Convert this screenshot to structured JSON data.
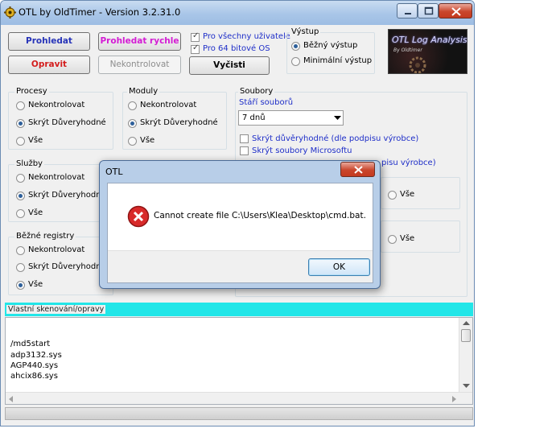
{
  "window": {
    "title": "OTL by OldTimer - Version 3.2.31.0"
  },
  "toolbar": {
    "scan_label": "Prohledat",
    "quick_scan_label": "Prohledat rychle",
    "fix_label": "Opravit",
    "no_check_label": "Nekontrolovat",
    "clean_label": "Vyčisti",
    "all_users_label": "Pro všechny uživatele",
    "x64_label": "Pro 64 bitové OS"
  },
  "output": {
    "title": "Výstup",
    "standard_label": "Běžný výstup",
    "minimal_label": "Minimální výstup"
  },
  "logo": {
    "title": "OTL Log Analysis",
    "subtitle": "By Oldtimer"
  },
  "processes": {
    "title": "Procesy",
    "opt1": "Nekontrolovat",
    "opt2": "Skrýt Důveryhodné",
    "opt3": "Vše"
  },
  "modules": {
    "title": "Moduly",
    "opt1": "Nekontrolovat",
    "opt2": "Skrýt Důveryhodné",
    "opt3": "Vše"
  },
  "files": {
    "title": "Soubory",
    "age_label": "Stáří souborů",
    "age_value": "7 dnů",
    "trusted_label": "Skrýt důvěryhodné (dle podpisu výrobce)",
    "microsoft_label": "Skrýt soubory Microsoftu",
    "partial_text": "pisu výrobce)"
  },
  "services": {
    "title": "Služby",
    "opt1": "Nekontrolovat",
    "opt2": "Skrýt Důveryhodné",
    "opt3": "Vše"
  },
  "registry": {
    "title": "Běžné registry",
    "opt1": "Nekontrolovat",
    "opt2": "Skrýt Důveryhodné",
    "opt3": "Vše"
  },
  "right_groups": {
    "all1": "Vše",
    "all2": "Vše"
  },
  "custom": {
    "title": "Vlastní skenování/opravy",
    "lines": [
      "/md5start",
      "adp3132.sys",
      "AGP440.sys",
      "ahcix86.sys"
    ]
  },
  "dialog": {
    "title": "OTL",
    "message": "Cannot create file C:\\Users\\Klea\\Desktop\\cmd.bat.",
    "ok_label": "OK"
  },
  "colors": {
    "accent_blue": "#1e2ec8",
    "cyan_bar": "#22e6e8",
    "error_red": "#d82a2a"
  }
}
